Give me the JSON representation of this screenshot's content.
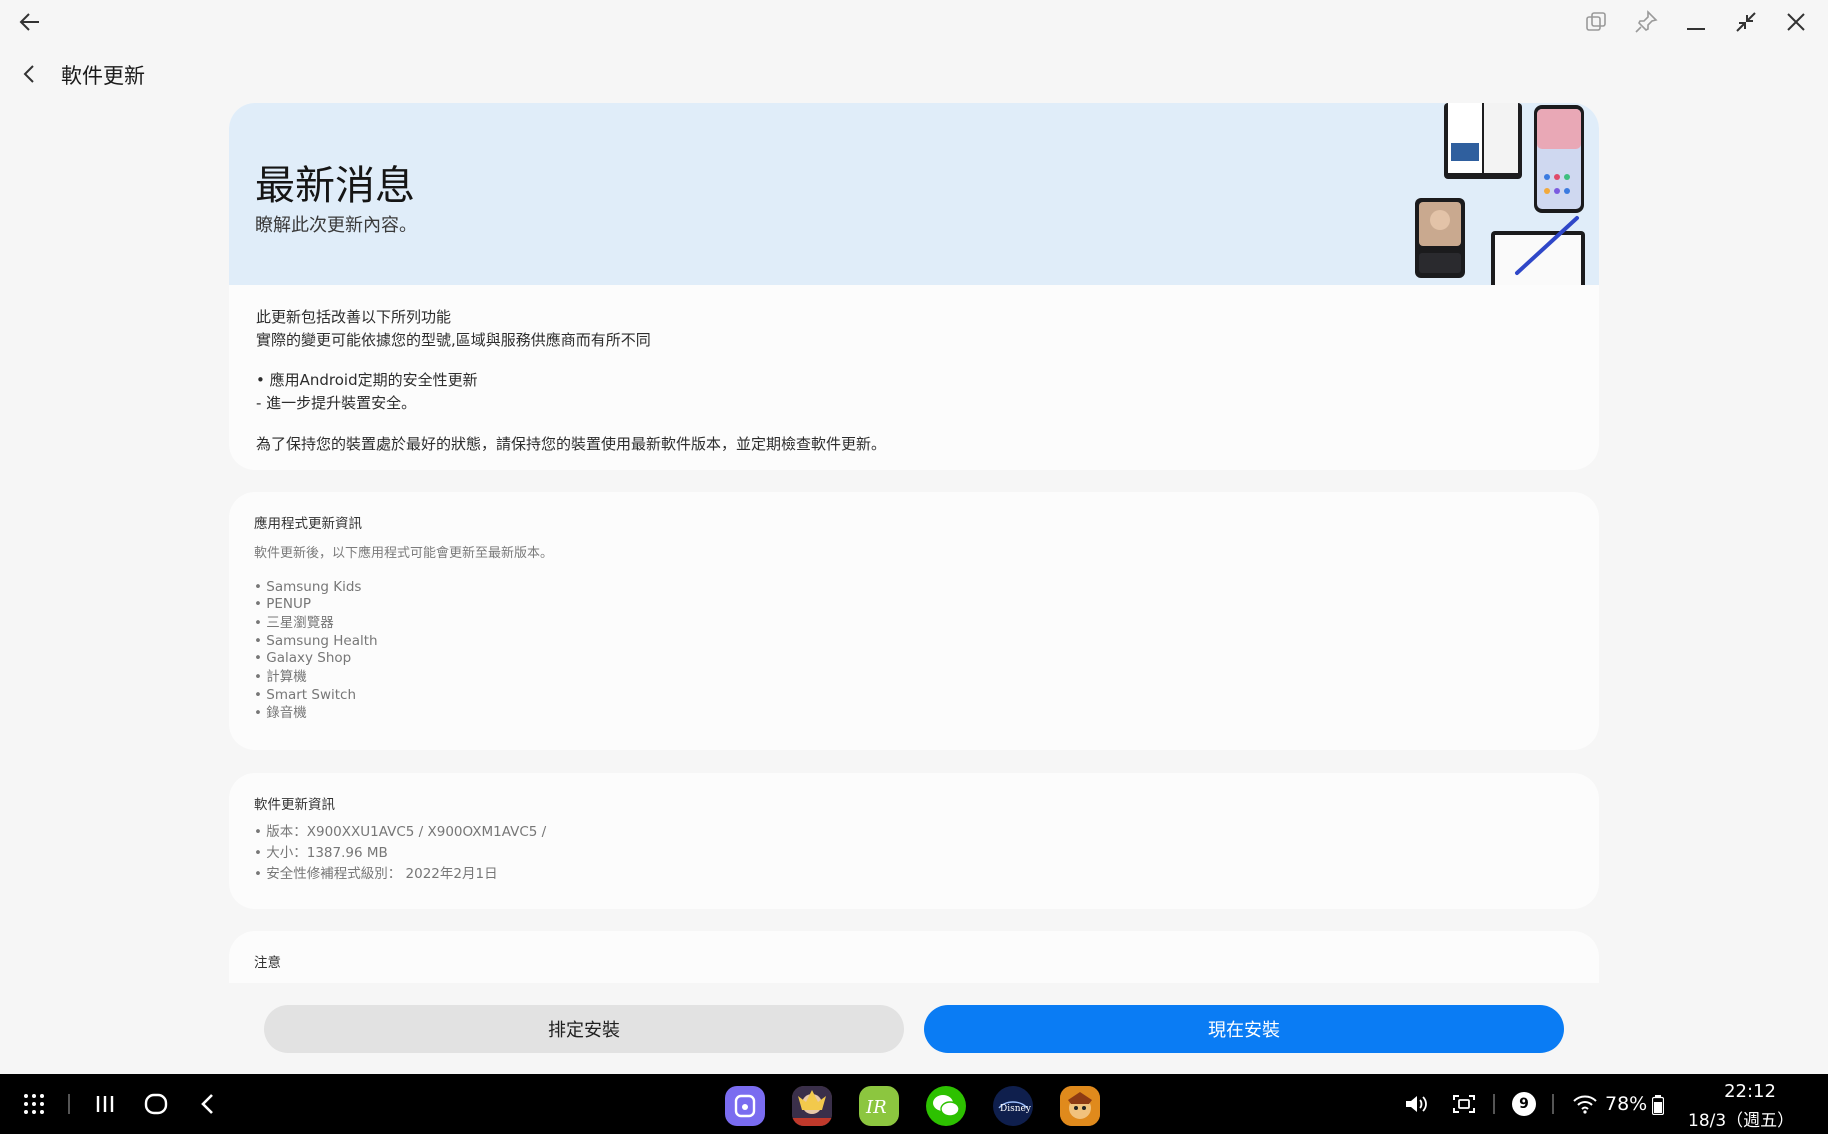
{
  "window": {
    "back_icon": "arrow-left-icon",
    "controls": [
      "snap-window-icon",
      "pin-icon",
      "minimize-icon",
      "restore-icon",
      "close-icon"
    ]
  },
  "header": {
    "title": "軟件更新"
  },
  "hero": {
    "title": "最新消息",
    "subtitle": "瞭解此次更新內容。",
    "colors": {
      "background": "#e0edf9"
    }
  },
  "whats_new": {
    "line1": "此更新包括改善以下所列功能",
    "line2": "實際的變更可能依據您的型號,區域與服務供應商而有所不同",
    "bullet1": "• 應用Android定期的安全性更新",
    "bullet1_sub": " - 進一步提升裝置安全。",
    "footer": "為了保持您的裝置處於最好的狀態，請保持您的裝置使用最新軟件版本，並定期檢查軟件更新。"
  },
  "app_updates": {
    "title": "應用程式更新資訊",
    "subtitle": "軟件更新後，以下應用程式可能會更新至最新版本。",
    "items": [
      "• Samsung Kids",
      "• PENUP",
      "• 三星瀏覽器",
      "• Samsung Health",
      "• Galaxy Shop",
      "• 計算機",
      "• Smart Switch",
      "• 錄音機"
    ]
  },
  "software_info": {
    "title": "軟件更新資訊",
    "version": "• 版本：X900XXU1AVC5 / X900OXM1AVC5 /",
    "size": "• 大小：1387.96 MB",
    "security_patch": "• 安全性修補程式級別： 2022年2月1日"
  },
  "notice": {
    "title": "注意"
  },
  "actions": {
    "schedule_label": "排定安裝",
    "install_now_label": "現在安裝",
    "colors": {
      "primary": "#0a7cf4",
      "secondary": "#e2e2e2"
    }
  },
  "taskbar": {
    "nav_icons": [
      "apps-grid-icon",
      "recents-icon",
      "home-icon",
      "back-icon"
    ],
    "apps": [
      "samsung-app-icon",
      "game-avatar-icon",
      "ir-app-icon",
      "wechat-icon",
      "disney-plus-icon",
      "clash-game-icon"
    ],
    "notification_count": "9",
    "battery": "78%",
    "time": "22:12",
    "date": "18/3（週五）"
  }
}
